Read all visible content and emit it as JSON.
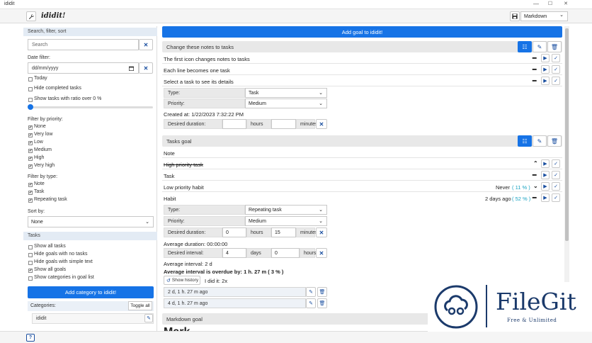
{
  "window": {
    "title": "ididit",
    "min": "—",
    "max": "☐",
    "close": "✕"
  },
  "toolbar": {
    "app_name": "ididit!",
    "format_select": "Markdown"
  },
  "sidebar": {
    "search_header": "Search, filter, sort",
    "search_placeholder": "Search",
    "date_filter_label": "Date filter:",
    "date_placeholder": "dd/mm/yyyy",
    "today": "Today",
    "hide_completed": "Hide completed tasks",
    "show_ratio": "Show tasks with ratio over 0 %",
    "priority_label": "Filter by priority:",
    "priorities": [
      {
        "label": "None",
        "checked": true
      },
      {
        "label": "Very low",
        "checked": true
      },
      {
        "label": "Low",
        "checked": true
      },
      {
        "label": "Medium",
        "checked": true
      },
      {
        "label": "High",
        "checked": true
      },
      {
        "label": "Very high",
        "checked": true
      }
    ],
    "type_label": "Filter by type:",
    "types": [
      {
        "label": "Note",
        "checked": true
      },
      {
        "label": "Task",
        "checked": true
      },
      {
        "label": "Repeating task",
        "checked": true
      }
    ],
    "sort_label": "Sort by:",
    "sort_value": "None",
    "tasks_header": "Tasks",
    "task_options": [
      {
        "label": "Show all tasks",
        "checked": false
      },
      {
        "label": "Hide goals with no tasks",
        "checked": false
      },
      {
        "label": "Hide goals with simple text",
        "checked": false
      },
      {
        "label": "Show all goals",
        "checked": true
      },
      {
        "label": "Show categories in goal list",
        "checked": false
      }
    ],
    "add_category": "Add category to ididit!",
    "categories_label": "Categories:",
    "toggle_all": "Toggle all",
    "category_name": "ididit"
  },
  "main": {
    "add_goal": "Add goal to ididit!",
    "goal1": {
      "title": "Change these notes to tasks",
      "rows": [
        "The first icon changes notes to tasks",
        "Each line becomes one task",
        "Select a task to see its details"
      ],
      "type_label": "Type:",
      "type_value": "Task",
      "priority_label": "Priority:",
      "priority_value": "Medium",
      "created": "Created at: 1/22/2023 7:32:22 PM",
      "duration_label": "Desired duration:",
      "hours": "hours",
      "minutes": "minutes"
    },
    "goal2": {
      "title": "Tasks goal",
      "note": "Note",
      "high": "High priority task",
      "task": "Task",
      "low_habit": "Low priority habit",
      "low_habit_status": "Never",
      "low_habit_pct": "( 11 % )",
      "habit": "Habit",
      "habit_status": "2 days ago",
      "habit_pct": "( 52 % )",
      "type_label": "Type:",
      "type_value": "Repeating task",
      "priority_label": "Priority:",
      "priority_value": "Medium",
      "duration_label": "Desired duration:",
      "dur_hours": "0",
      "hours": "hours",
      "dur_minutes": "15",
      "minutes": "minutes",
      "avg_duration": "Average duration: 00:00:00",
      "interval_label": "Desired interval:",
      "interval_days": "4",
      "days": "days",
      "interval_hours": "0",
      "avg_interval": "Average interval: 2 d",
      "overdue": "Average interval is overdue by: 1 h. 27 m ( 3 % )",
      "show_history": "Show history",
      "did_it": "I did it: 2x",
      "history": [
        "2 d, 1 h. 27 m ago",
        "4 d, 1 h. 27 m ago"
      ]
    },
    "goal3": {
      "title": "Markdown goal",
      "preview": "Mark"
    }
  },
  "watermark": {
    "brand": "FileGit",
    "tagline": "Free & Unlimited"
  },
  "colors": {
    "accent": "#1673e6",
    "teal": "#1aa3c2"
  }
}
